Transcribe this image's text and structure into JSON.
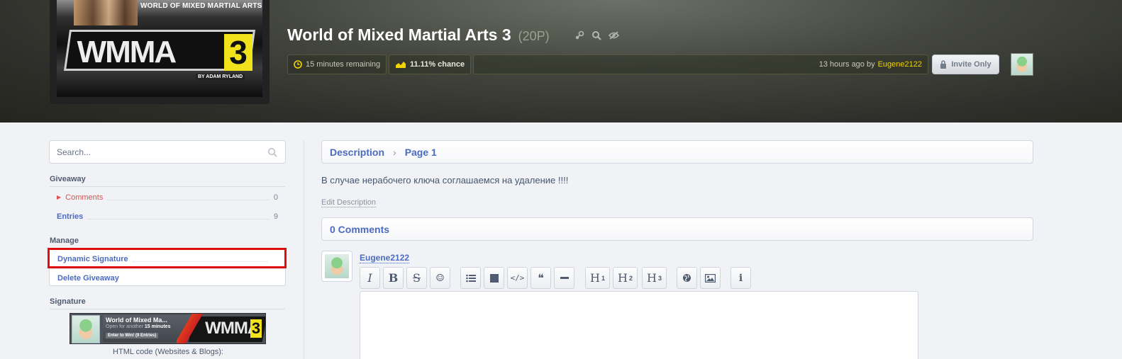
{
  "giveaway": {
    "game_art": {
      "banner": "WORLD OF MIXED MARTIAL ARTS",
      "logo": "WMMA",
      "logo_number": "3",
      "byline": "BY ADAM RYLAND"
    },
    "title": "World of Mixed Martial Arts 3",
    "points": "(20P)",
    "icons": [
      "steam-icon",
      "search-icon",
      "hide-icon"
    ],
    "time_remaining": "15 minutes remaining",
    "chance": "11.11% chance",
    "created": "13 hours ago by",
    "creator": "Eugene2122",
    "invite_label": "Invite Only",
    "colors": {
      "accent_yellow": "#f1d400",
      "link_blue": "#4b6bbf",
      "active_red": "#d9534f",
      "highlight_red": "#e00d0d"
    }
  },
  "sidebar": {
    "search_placeholder": "Search...",
    "giveaway_heading": "Giveaway",
    "items": [
      {
        "label": "Comments",
        "count": "0"
      },
      {
        "label": "Entries",
        "count": "9"
      }
    ],
    "manage_heading": "Manage",
    "manage_items": [
      {
        "label": "Dynamic Signature"
      },
      {
        "label": "Delete Giveaway"
      }
    ],
    "signature_heading": "Signature",
    "signature": {
      "title": "World of Mixed Ma...",
      "open_text": "Open for another",
      "time": "15 minutes",
      "enter_text": "Enter to Win!",
      "entries_text": "(9 Entries)",
      "logo": "WMMA",
      "logo_number": "3"
    },
    "html_code_label": "HTML code (Websites & Blogs):"
  },
  "main": {
    "breadcrumb": [
      "Description",
      "Page 1"
    ],
    "description": "В случае нерабочего ключа соглашаемся на удаление !!!!",
    "edit_description": "Edit Description",
    "comments_title": "0 Comments",
    "comment_user": "Eugene2122",
    "toolbar": [
      {
        "name": "italic-button",
        "glyph": "I"
      },
      {
        "name": "bold-button",
        "glyph": "B"
      },
      {
        "name": "strikethrough-button",
        "glyph": "S"
      },
      {
        "name": "emoji-button",
        "glyph": "☺"
      },
      {
        "name": "list-button",
        "glyph": "≡"
      },
      {
        "name": "spoiler-button",
        "glyph": "■"
      },
      {
        "name": "code-button",
        "glyph": "</>"
      },
      {
        "name": "quote-button",
        "glyph": "❝"
      },
      {
        "name": "horizontal-rule-button",
        "glyph": "—"
      },
      {
        "name": "heading1-button",
        "glyph": "H",
        "sup": "1"
      },
      {
        "name": "heading2-button",
        "glyph": "H",
        "sup": "2"
      },
      {
        "name": "heading3-button",
        "glyph": "H",
        "sup": "3"
      },
      {
        "name": "link-button",
        "glyph": "🌐"
      },
      {
        "name": "image-button",
        "glyph": "🖼"
      },
      {
        "name": "help-button",
        "glyph": "i"
      }
    ]
  }
}
